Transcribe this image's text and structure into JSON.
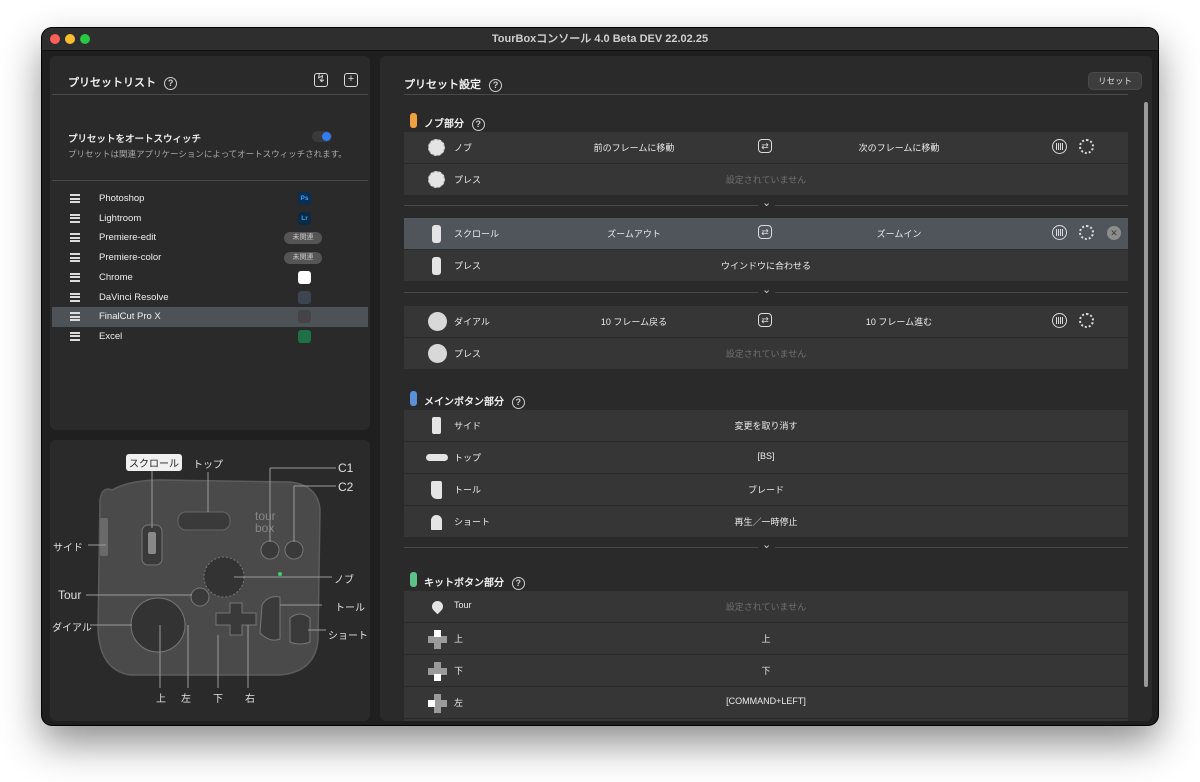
{
  "window": {
    "title": "TourBoxコンソール 4.0 Beta DEV 22.02.25"
  },
  "preset_list": {
    "title": "プリセットリスト",
    "auto_switch_label": "プリセットをオートスウィッチ",
    "auto_switch_on": true,
    "auto_switch_desc": "プリセットは関連アプリケーションによってオートスウィッチされます。",
    "items": [
      {
        "name": "Photoshop",
        "app": "Ps",
        "app_color": "#0b2d4f",
        "app_text_color": "#31a8ff"
      },
      {
        "name": "Lightroom",
        "app": "Lr",
        "app_color": "#0c2a45",
        "app_text_color": "#31a8ff"
      },
      {
        "name": "Premiere-edit",
        "unrelated": "未関連"
      },
      {
        "name": "Premiere-color",
        "unrelated": "未関連"
      },
      {
        "name": "Chrome",
        "app": "",
        "app_color": "#ffffff"
      },
      {
        "name": "DaVinci Resolve",
        "app": "",
        "app_color": "#3d4550"
      },
      {
        "name": "FinalCut Pro X",
        "app": "",
        "app_color": "#444444",
        "selected": true
      },
      {
        "name": "Excel",
        "app": "",
        "app_color": "#1e7145"
      }
    ]
  },
  "diagram": {
    "labels": {
      "scroll": "スクロール",
      "top": "トップ",
      "c1": "C1",
      "c2": "C2",
      "side": "サイド",
      "knob": "ノブ",
      "tour": "Tour",
      "tall": "トール",
      "dial": "ダイアル",
      "short": "ショート",
      "up": "上",
      "left": "左",
      "down": "下",
      "right": "右"
    }
  },
  "preset_settings": {
    "title": "プリセット設定",
    "reset_label": "リセット",
    "sections": {
      "knob": {
        "title": "ノブ部分",
        "color": "#f0a040"
      },
      "main": {
        "title": "メインボタン部分",
        "color": "#5b8fd6"
      },
      "kit": {
        "title": "キットボタン部分",
        "color": "#5cc28a"
      }
    },
    "knob_rows": [
      {
        "label": "ノブ",
        "ccw": "前のフレームに移動",
        "cw": "次のフレームに移動"
      },
      {
        "label": "プレス",
        "value": "設定されていません"
      }
    ],
    "scroll_rows": [
      {
        "label": "スクロール",
        "ccw": "ズームアウト",
        "cw": "ズームイン"
      },
      {
        "label": "プレス",
        "value": "ウインドウに合わせる"
      }
    ],
    "dial_rows": [
      {
        "label": "ダイアル",
        "ccw": "10 フレーム戻る",
        "cw": "10 フレーム進む"
      },
      {
        "label": "プレス",
        "value": "設定されていません"
      }
    ],
    "main_rows": [
      {
        "label": "サイド",
        "value": "変更を取り消す"
      },
      {
        "label": "トップ",
        "value": "[BS]"
      },
      {
        "label": "トール",
        "value": "ブレード"
      },
      {
        "label": "ショート",
        "value": "再生／一時停止"
      }
    ],
    "kit_rows": [
      {
        "label": "Tour",
        "value": "設定されていません"
      },
      {
        "label": "上",
        "value": "上"
      },
      {
        "label": "下",
        "value": "下"
      },
      {
        "label": "左",
        "value": "[COMMAND+LEFT]"
      }
    ]
  }
}
